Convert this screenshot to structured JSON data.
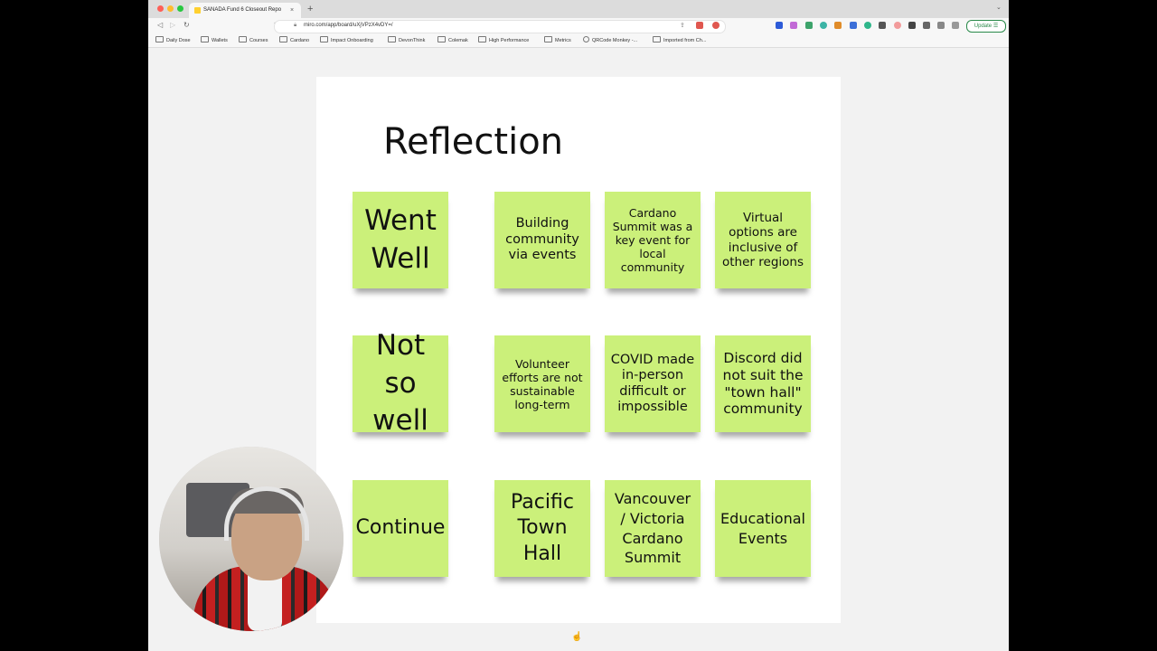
{
  "browser": {
    "tab_title": "SANADA Fund 6 Closeout Repo",
    "tab_close": "×",
    "new_tab": "+",
    "url": "miro.com/app/board/uXjVPzX4vDY=/",
    "update_label": "Update",
    "bookmarks": [
      "Daily Dose",
      "Wallets",
      "Courses",
      "Cardano",
      "Impact Onboarding",
      "DevonThink",
      "Colemak",
      "High Performance",
      "Metrics",
      "QRCode Monkey -...",
      "Imported from Ch..."
    ]
  },
  "board": {
    "title": "Reflection",
    "notes": [
      {
        "text": "Went Well"
      },
      {
        "text": "Building community via events"
      },
      {
        "text": "Cardano Summit was a key event for local community"
      },
      {
        "text": "Virtual options are inclusive of other regions"
      },
      {
        "text": "Not so well"
      },
      {
        "text": "Volunteer efforts are not sustainable long-term"
      },
      {
        "text": "COVID made in-person difficult or impossible"
      },
      {
        "text": "Discord did not suit the \"town hall\" community"
      },
      {
        "text": "Continue"
      },
      {
        "text": "Pacific Town Hall"
      },
      {
        "text": "Vancouver / Victoria Cardano Summit"
      },
      {
        "text": "Educational Events"
      }
    ],
    "note_color": "#cbf07a"
  }
}
